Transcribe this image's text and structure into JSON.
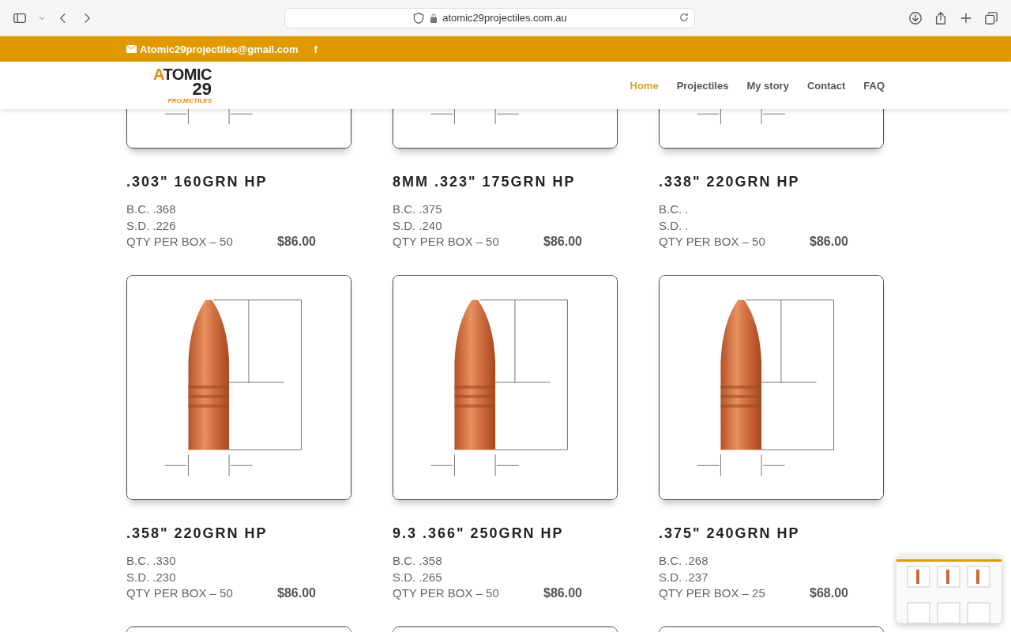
{
  "browser": {
    "url": "atomic29projectiles.com.au"
  },
  "topbar": {
    "email": "Atomic29projectiles@gmail.com",
    "social": "f"
  },
  "logo": {
    "name": "ATOMIC",
    "number": "29",
    "tagline": "PROJECTILES"
  },
  "nav": [
    {
      "label": "Home",
      "selected": true
    },
    {
      "label": "Projectiles",
      "selected": false
    },
    {
      "label": "My story",
      "selected": false
    },
    {
      "label": "Contact",
      "selected": false
    },
    {
      "label": "FAQ",
      "selected": false
    }
  ],
  "products": [
    {
      "title": ".303\" 160GRN HP",
      "bc": "B.C. .368",
      "sd": "S.D. .226",
      "qty": "QTY PER BOX – 50",
      "price": "$86.00"
    },
    {
      "title": "8MM .323\" 175GRN HP",
      "bc": "B.C. .375",
      "sd": "S.D. .240",
      "qty": "QTY PER BOX – 50",
      "price": "$86.00"
    },
    {
      "title": ".338\" 220GRN HP",
      "bc": "B.C. .",
      "sd": "S.D. .",
      "qty": "QTY PER BOX – 50",
      "price": "$86.00"
    },
    {
      "title": ".358\" 220GRN HP",
      "bc": "B.C. .330",
      "sd": "S.D. .230",
      "qty": "QTY PER BOX – 50",
      "price": "$86.00"
    },
    {
      "title": "9.3 .366\" 250GRN HP",
      "bc": "B.C. .358",
      "sd": "S.D. .265",
      "qty": "QTY PER BOX – 50",
      "price": "$86.00"
    },
    {
      "title": ".375\" 240GRN HP",
      "bc": "B.C. .268",
      "sd": "S.D. .237",
      "qty": "QTY PER BOX – 25",
      "price": "$68.00"
    }
  ]
}
